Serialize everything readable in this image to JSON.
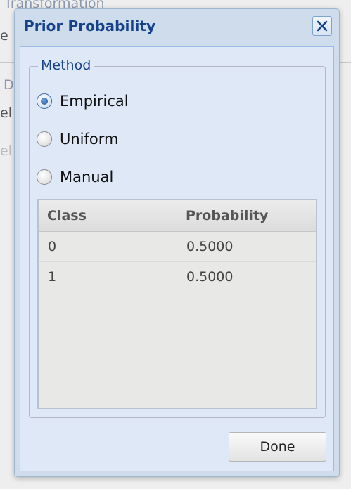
{
  "background": {
    "fragment_top": "Transformation",
    "fragment_e": "e",
    "fragment_d": "D",
    "fragment_el1": "el",
    "fragment_el2": "el"
  },
  "dialog": {
    "title": "Prior Probability",
    "close_icon": "close-x-icon",
    "method": {
      "legend": "Method",
      "options": [
        {
          "label": "Empirical",
          "checked": true
        },
        {
          "label": "Uniform",
          "checked": false
        },
        {
          "label": "Manual",
          "checked": false
        }
      ]
    },
    "grid": {
      "columns": [
        "Class",
        "Probability"
      ],
      "rows": [
        {
          "class": "0",
          "probability": "0.5000"
        },
        {
          "class": "1",
          "probability": "0.5000"
        }
      ]
    },
    "done_label": "Done"
  },
  "colors": {
    "title": "#15428b",
    "dialog_frame": "#cfdcec",
    "dialog_body": "#dfe8f6",
    "grid_bg": "#e8e8e7"
  }
}
